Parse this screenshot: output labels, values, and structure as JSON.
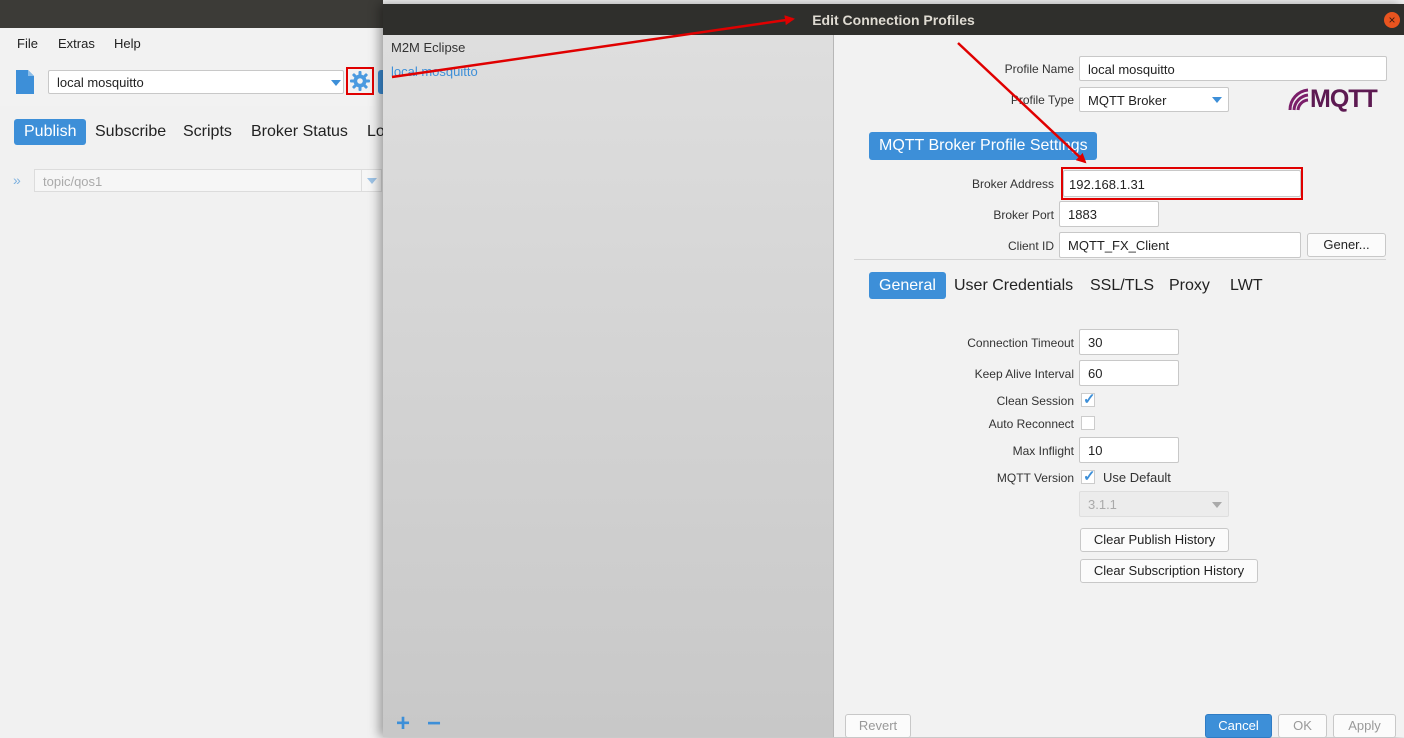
{
  "menu": [
    "File",
    "Extras",
    "Help"
  ],
  "toolbar": {
    "profile": "local mosquitto"
  },
  "main_tabs": [
    "Publish",
    "Subscribe",
    "Scripts",
    "Broker Status",
    "Lo"
  ],
  "topic": {
    "value": "topic/qos1"
  },
  "dialog": {
    "title": "Edit Connection Profiles",
    "profiles": [
      "M2M Eclipse",
      "local mosquitto"
    ],
    "profile_name_label": "Profile Name",
    "profile_name": "local mosquitto",
    "profile_type_label": "Profile Type",
    "profile_type": "MQTT Broker",
    "logo_text": "MQTT",
    "section_title": "MQTT Broker Profile Settings",
    "broker_address_label": "Broker Address",
    "broker_address": "192.168.1.31",
    "broker_port_label": "Broker Port",
    "broker_port": "1883",
    "client_id_label": "Client ID",
    "client_id": "MQTT_FX_Client",
    "generate_label": "Gener...",
    "tabs": [
      "General",
      "User Credentials",
      "SSL/TLS",
      "Proxy",
      "LWT"
    ],
    "general": {
      "connection_timeout_label": "Connection Timeout",
      "connection_timeout": "30",
      "keep_alive_label": "Keep Alive Interval",
      "keep_alive": "60",
      "clean_session_label": "Clean Session",
      "clean_session": true,
      "auto_reconnect_label": "Auto Reconnect",
      "auto_reconnect": false,
      "max_inflight_label": "Max Inflight",
      "max_inflight": "10",
      "mqtt_version_label": "MQTT Version",
      "use_default_label": "Use Default",
      "use_default": true,
      "version": "3.1.1",
      "clear_publish_label": "Clear Publish History",
      "clear_subscription_label": "Clear Subscription History"
    },
    "footer": {
      "revert": "Revert",
      "cancel": "Cancel",
      "ok": "OK",
      "apply": "Apply"
    }
  },
  "colors": {
    "accent": "#3d8fd8",
    "highlight": "#e00000",
    "titlebar": "#2f2f2c"
  }
}
